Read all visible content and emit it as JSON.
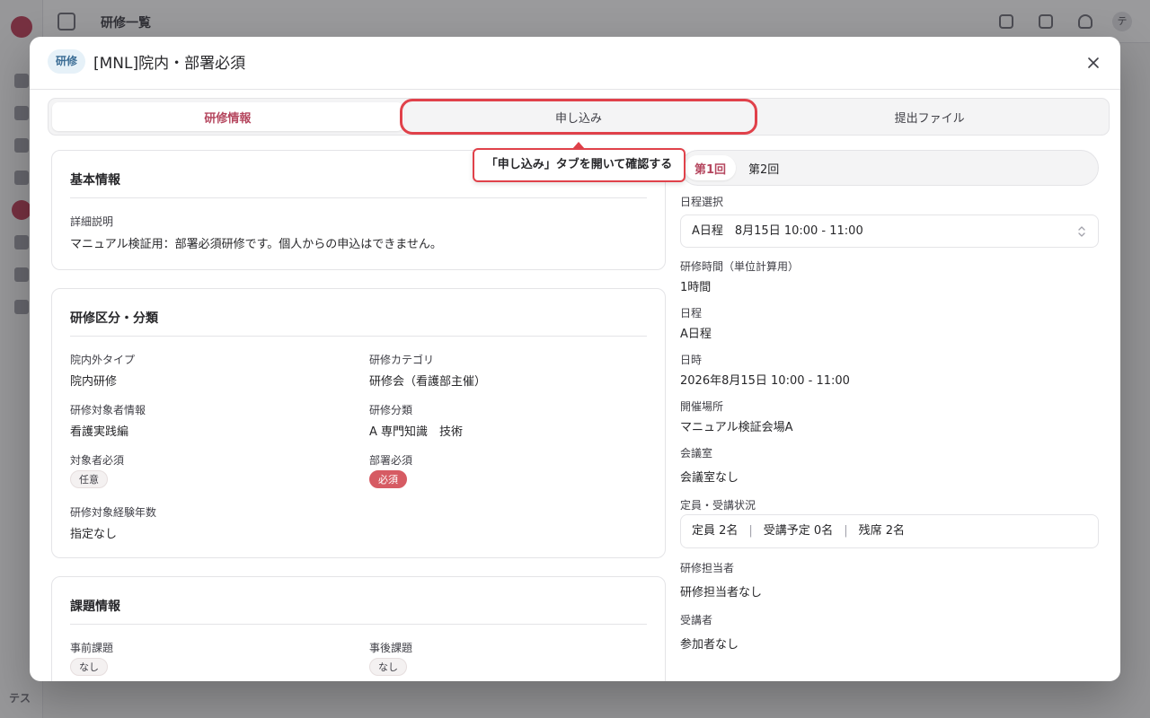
{
  "background": {
    "page_title": "研修一覧",
    "user_initials": "テス",
    "avatar_letter": "テ"
  },
  "modal": {
    "badge": "研修",
    "title": "[MNL]院内・部署必須"
  },
  "tabs": [
    {
      "label": "研修情報",
      "active": true
    },
    {
      "label": "申し込み",
      "active": false
    },
    {
      "label": "提出ファイル",
      "active": false
    }
  ],
  "callout": {
    "text": "「申し込み」タブを開いて確認する"
  },
  "basic_info": {
    "title": "基本情報",
    "description_label": "詳細説明",
    "description_value": "マニュアル検証用：部署必須研修です。個人からの申込はできません。"
  },
  "classification": {
    "title": "研修区分・分類",
    "inout_type_label": "院内外タイプ",
    "inout_type_value": "院内研修",
    "category_label": "研修カテゴリ",
    "category_value": "研修会（看護部主催）",
    "target_info_label": "研修対象者情報",
    "target_info_value": "看護実践編",
    "classification_label": "研修分類",
    "classification_value": "A 専門知識　技術",
    "target_required_label": "対象者必須",
    "target_required_value": "任意",
    "dept_required_label": "部署必須",
    "dept_required_value": "必須",
    "experience_label": "研修対象経験年数",
    "experience_value": "指定なし"
  },
  "assignments": {
    "title": "課題情報",
    "pre_label": "事前課題",
    "pre_value": "なし",
    "post_label": "事後課題",
    "post_value": "なし"
  },
  "sessions": {
    "tabs": [
      {
        "label": "第1回",
        "active": true
      },
      {
        "label": "第2回",
        "active": false
      }
    ],
    "schedule_select_label": "日程選択",
    "schedule_select_value": "A日程　8月15日 10:00 - 11:00",
    "hours_label": "研修時間（単位計算用）",
    "hours_value": "1時間",
    "schedule_label": "日程",
    "schedule_value": "A日程",
    "datetime_label": "日時",
    "datetime_value": "2026年8月15日 10:00 - 11:00",
    "venue_label": "開催場所",
    "venue_value": "マニュアル検証会場A",
    "room_label": "会議室",
    "room_value": "会議室なし",
    "capacity_label": "定員・受講状況",
    "capacity": "定員 2名",
    "enrolled": "受講予定 0名",
    "remaining": "残席 2名",
    "instructor_label": "研修担当者",
    "instructor_value": "研修担当者なし",
    "participants_label": "受講者",
    "participants_value": "参加者なし"
  },
  "colors": {
    "accent": "#b5475f",
    "highlight_red": "#e0414a",
    "badge_blue": "#3b6d95",
    "required_pill": "#d65b63"
  }
}
